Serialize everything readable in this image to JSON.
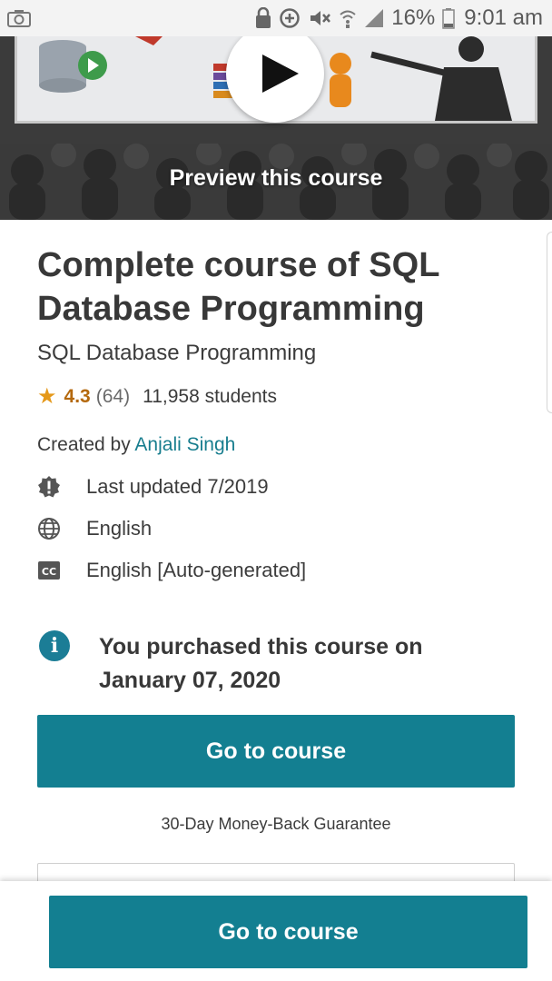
{
  "status_bar": {
    "battery_percent": "16%",
    "time": "9:01 am"
  },
  "preview": {
    "label": "Preview this course"
  },
  "course": {
    "title": "Complete course of SQL Database Programming",
    "subtitle": "SQL Database Programming",
    "rating": "4.3",
    "rating_count": "(64)",
    "students": "11,958 students",
    "created_by_label": "Created by",
    "author": "Anjali Singh",
    "last_updated": "Last updated 7/2019",
    "language": "English",
    "captions": "English [Auto-generated]"
  },
  "purchase": {
    "note": "You purchased this course on January 07, 2020"
  },
  "actions": {
    "go_to_course": "Go to course",
    "guarantee": "30-Day Money-Back Guarantee",
    "sticky_go_to_course": "Go to course"
  },
  "colors": {
    "accent": "#137f91",
    "star": "#e59819",
    "author_link": "#177d8e"
  }
}
